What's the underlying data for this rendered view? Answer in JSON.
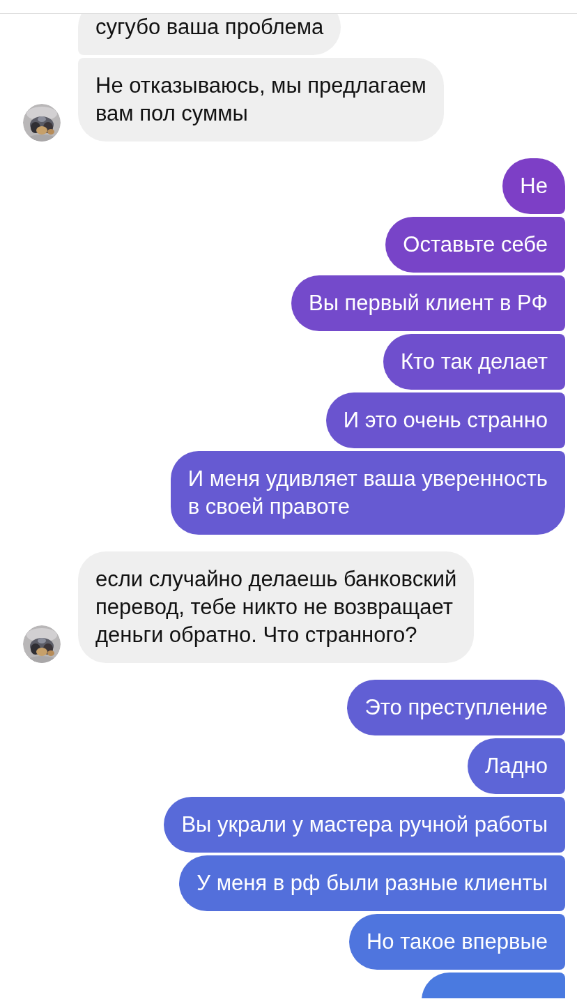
{
  "groups": [
    {
      "kind": "incoming",
      "messages": [
        {
          "lines": [
            "сугубо ваша проблема"
          ]
        },
        {
          "lines": [
            "Не отказываюсь, мы предлагаем",
            "вам пол суммы"
          ]
        }
      ]
    },
    {
      "kind": "outgoing",
      "messages": [
        {
          "lines": [
            "Не"
          ]
        },
        {
          "lines": [
            "Оставьте себе"
          ]
        },
        {
          "lines": [
            "Вы первый клиент в РФ"
          ]
        },
        {
          "lines": [
            "Кто так делает"
          ]
        },
        {
          "lines": [
            "И это очень странно"
          ]
        },
        {
          "lines": [
            "И меня удивляет ваша уверенность",
            "в своей правоте"
          ]
        }
      ]
    },
    {
      "kind": "incoming",
      "messages": [
        {
          "lines": [
            "если случайно делаешь банковский",
            "перевод, тебе никто не возвращает",
            "деньги обратно. Что странного?"
          ]
        }
      ]
    },
    {
      "kind": "outgoing",
      "messages": [
        {
          "lines": [
            "Это преступление"
          ]
        },
        {
          "lines": [
            "Ладно"
          ]
        },
        {
          "lines": [
            "Вы украли у мастера ручной работы"
          ]
        },
        {
          "lines": [
            "У меня в рф были разные клиенты"
          ]
        },
        {
          "lines": [
            "Но такое впервые"
          ]
        },
        {
          "kind": "partial"
        }
      ]
    }
  ]
}
